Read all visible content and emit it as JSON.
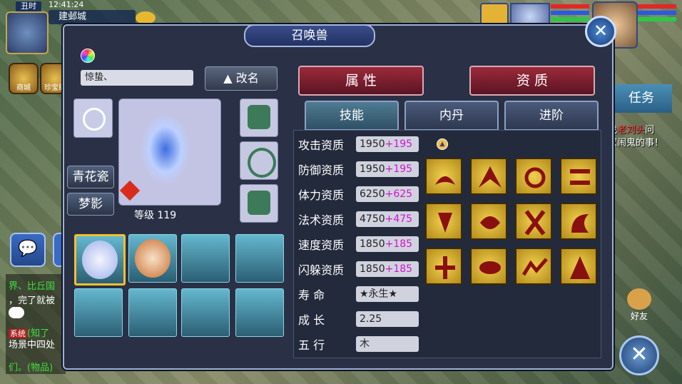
{
  "hud": {
    "clock": "丑时",
    "time": "12:41:24",
    "city": "建邺城",
    "mall": "商城",
    "treasure": "珍宝阁",
    "quest": "任务",
    "quest_text_1": "找",
    "quest_text_red": "老刘头",
    "quest_text_2": "问",
    "quest_text_3": "家闹鬼的事！",
    "friends": "好友"
  },
  "chat": {
    "line1": "界、比丘国",
    "line2": "，完了就被",
    "sys_tag": "系统",
    "line3": "(知了",
    "line4": "场景中四处",
    "line5": "们。(物品)",
    "colors": {
      "green": "#3ee03e",
      "system": "#b02020"
    }
  },
  "panel": {
    "title": "召唤兽",
    "pet_name": "惊蛰、",
    "rename_label": "▲ 改名",
    "btn_qinghuaci": "青花瓷",
    "btn_mengying": "梦影",
    "level": "等级 119",
    "tabs_top": [
      "属 性",
      "资 质"
    ],
    "tabs_sub": [
      "技能",
      "内丹",
      "进阶"
    ],
    "active_sub_tab": "技能",
    "attributes": [
      {
        "label": "攻击资质",
        "base": "1950",
        "bonus": "+195"
      },
      {
        "label": "防御资质",
        "base": "1950",
        "bonus": "+195"
      },
      {
        "label": "体力资质",
        "base": "6250",
        "bonus": "+625"
      },
      {
        "label": "法术资质",
        "base": "4750",
        "bonus": "+475"
      },
      {
        "label": "速度资质",
        "base": "1850",
        "bonus": "+185"
      },
      {
        "label": "闪躲资质",
        "base": "1850",
        "bonus": "+185"
      },
      {
        "label": "寿  命",
        "base": "★永生★",
        "bonus": ""
      },
      {
        "label": "成  长",
        "base": "2.25",
        "bonus": ""
      },
      {
        "label": "五  行",
        "base": "木",
        "bonus": ""
      }
    ],
    "skills": [
      "skill-1",
      "skill-2",
      "skill-3",
      "skill-4",
      "skill-5",
      "skill-6",
      "skill-7",
      "skill-8",
      "skill-9",
      "skill-10",
      "skill-11",
      "skill-12"
    ],
    "accent": {
      "bonus": "#d014d0",
      "tab_red": "#9b2a3a",
      "slot_blue": "#64b8cf",
      "gold": "#f0c030"
    }
  }
}
